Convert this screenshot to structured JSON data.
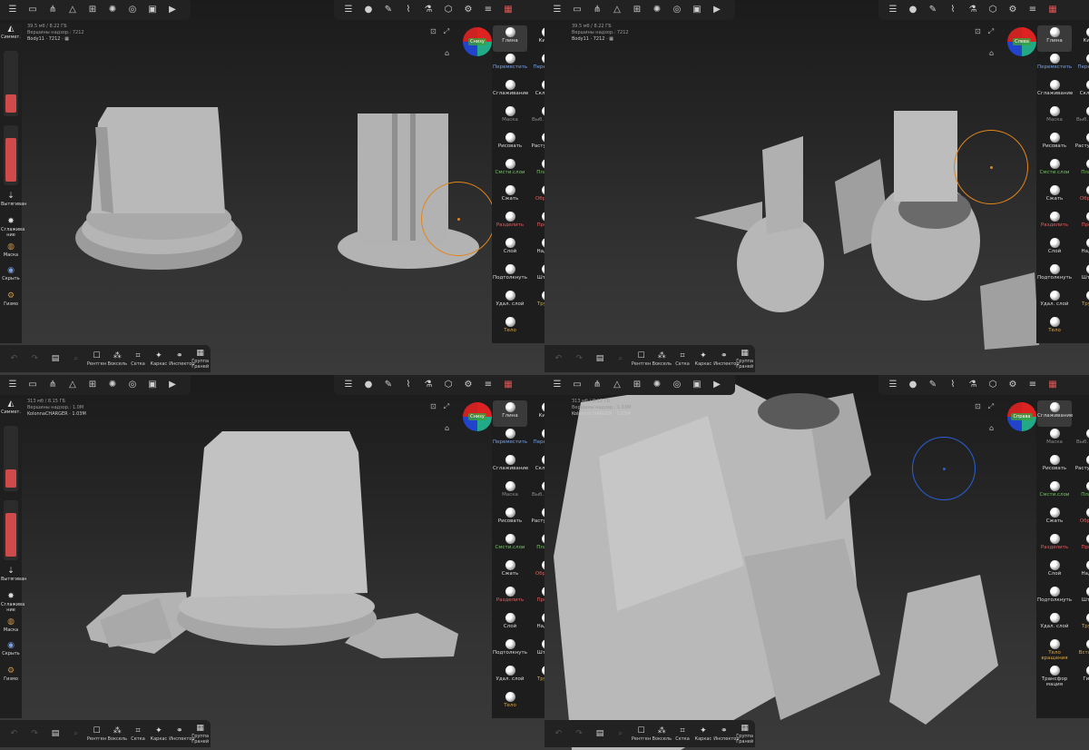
{
  "topbar_icons": [
    "layers-icon",
    "folder-icon",
    "share-icon",
    "scene-icon",
    "topology-icon",
    "light-icon",
    "material-icon",
    "image-icon",
    "camera-icon"
  ],
  "mid_icons": [
    "layers-icon",
    "material-sphere-icon",
    "pen-icon",
    "brush-icon",
    "flask-icon",
    "cube-icon",
    "settings-icon",
    "sliders-icon",
    "calendar-icon"
  ],
  "views": [
    {
      "info_line1": "39.5 мб / 8.22 ГБ",
      "info_line2": "Вершины надзор.: 7212",
      "object_name": "Body11 · 7212 · ▦",
      "cube_label": "Снизу",
      "left": [
        {
          "label": "Симмет.",
          "icon": "symmetry-icon"
        },
        {
          "label": "Вытягиван",
          "icon": "extrude-icon"
        },
        {
          "label": "Сглажива ние",
          "icon": "smooth-icon"
        },
        {
          "label": "Маска",
          "icon": "mask-icon"
        },
        {
          "label": "Скрыть",
          "icon": "hide-icon"
        },
        {
          "label": "Гизмо",
          "icon": "gizmo-icon"
        }
      ],
      "tools": [
        [
          "Глина",
          "Кисть"
        ],
        [
          "Переместить",
          "Перетаск."
        ],
        [
          "Сглаживание",
          "Складка"
        ],
        [
          "Маска",
          "Выб. маску"
        ],
        [
          "Рисовать",
          "Растушевк."
        ],
        [
          "Смсти.слои",
          "Планар"
        ],
        [
          "Сжать",
          "Обрезка"
        ],
        [
          "Разделить",
          "Проект"
        ],
        [
          "Слой",
          "Надуть"
        ],
        [
          "Подтолкнуть",
          "Штамп"
        ],
        [
          "Удал. слой",
          "Трубка"
        ],
        [
          "Тело",
          ""
        ]
      ]
    },
    {
      "info_line1": "39.5 мб / 8.22 ГБ",
      "info_line2": "Вершины надзор.: 7212",
      "object_name": "Body11 · 7212 · ▦",
      "cube_label": "Слева",
      "left": [],
      "tools": [
        [
          "Глина",
          "Кисть"
        ],
        [
          "Переместить",
          "Перетаск."
        ],
        [
          "Сглаживание",
          "Складка"
        ],
        [
          "Маска",
          "Выб. маску"
        ],
        [
          "Рисовать",
          "Растушевка"
        ],
        [
          "Смсти.слои",
          "Планар"
        ],
        [
          "Сжать",
          "Обрезка"
        ],
        [
          "Разделить",
          "Проект"
        ],
        [
          "Слой",
          "Надуть"
        ],
        [
          "Подтолкнуть",
          "Штамп"
        ],
        [
          "Удал. слой",
          "Трубка"
        ],
        [
          "Тело",
          ""
        ]
      ]
    },
    {
      "info_line1": "313 мб / 8.15 ГБ",
      "info_line2": "Вершины надзор.: 1.0M",
      "object_name": "KolonnaCHARGER · 1.03M",
      "cube_label": "Снизу",
      "left": [
        {
          "label": "Симмет.",
          "icon": "symmetry-icon"
        },
        {
          "label": "Вытягиван",
          "icon": "extrude-icon"
        },
        {
          "label": "Сглажива ние",
          "icon": "smooth-icon"
        },
        {
          "label": "Маска",
          "icon": "mask-icon"
        },
        {
          "label": "Скрыть",
          "icon": "hide-icon"
        },
        {
          "label": "Гизмо",
          "icon": "gizmo-icon"
        }
      ],
      "tools": [
        [
          "Глина",
          "Кисть"
        ],
        [
          "Переместить",
          "Перетаск."
        ],
        [
          "Сглаживание",
          "Складка"
        ],
        [
          "Маска",
          "Выб. маску"
        ],
        [
          "Рисовать",
          "Растушевк."
        ],
        [
          "Смсти.слои",
          "Планар"
        ],
        [
          "Сжать",
          "Обрезка"
        ],
        [
          "Разделить",
          "Проект"
        ],
        [
          "Слой",
          "Надуть"
        ],
        [
          "Подтолкнуть",
          "Штамп"
        ],
        [
          "Удал. слой",
          "Трубка"
        ],
        [
          "Тело",
          ""
        ]
      ]
    },
    {
      "info_line1": "313 мб / 8.12 ГБ",
      "info_line2": "Вершины надзор.: 1.03M",
      "object_name": "KolonnaCHARGER · 1.03M",
      "cube_label": "Справа",
      "left": [],
      "tools": [
        [
          "Сглаживание",
          ""
        ],
        [
          "Маска",
          "Выб. маску"
        ],
        [
          "Рисовать",
          "Растушевка"
        ],
        [
          "Смсти.слои",
          "Планар"
        ],
        [
          "Сжать",
          "Обрезка"
        ],
        [
          "Разделить",
          "Проект"
        ],
        [
          "Слой",
          "Надуть"
        ],
        [
          "Подтолкнуть",
          "Штамп"
        ],
        [
          "Удал. слой",
          "Трубка"
        ],
        [
          "Тело вращения",
          "Вставить"
        ],
        [
          "Трансфор мация",
          "Гизмо"
        ]
      ]
    }
  ],
  "bottom": [
    {
      "label": "",
      "icon": "undo-icon",
      "glyph": "↶"
    },
    {
      "label": "",
      "icon": "redo-icon",
      "glyph": "↷"
    },
    {
      "label": "",
      "icon": "history-icon",
      "glyph": "▤"
    },
    {
      "label": "",
      "icon": "search-icon",
      "glyph": "⌕"
    },
    {
      "label": "Рентген",
      "icon": "xray-icon",
      "glyph": "☐"
    },
    {
      "label": "Воксель",
      "icon": "voxel-icon",
      "glyph": "⁂"
    },
    {
      "label": "Сетка",
      "icon": "grid-icon",
      "glyph": "⌗"
    },
    {
      "label": "Каркас",
      "icon": "wireframe-icon",
      "glyph": "✦"
    },
    {
      "label": "Инспектор",
      "icon": "inspector-icon",
      "glyph": "⚭"
    },
    {
      "label": "Группа Граней",
      "icon": "facegroup-icon",
      "glyph": "▦"
    }
  ],
  "accent_orange": "#e2851a",
  "accent_blue": "#2a5fd6",
  "accent_red": "#cf4a4a"
}
